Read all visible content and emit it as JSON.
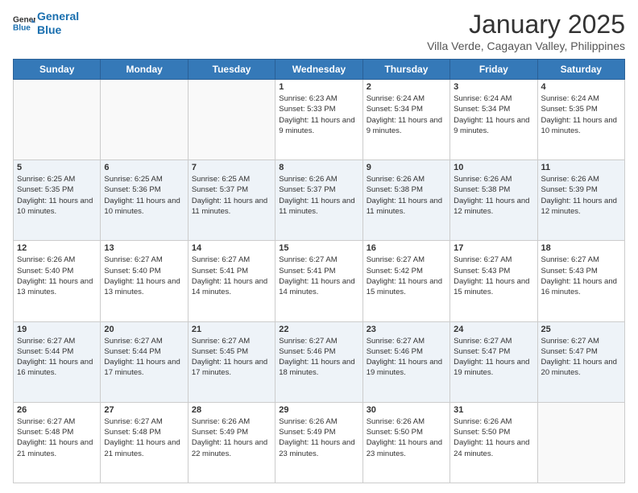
{
  "logo": {
    "line1": "General",
    "line2": "Blue"
  },
  "title": "January 2025",
  "subtitle": "Villa Verde, Cagayan Valley, Philippines",
  "weekdays": [
    "Sunday",
    "Monday",
    "Tuesday",
    "Wednesday",
    "Thursday",
    "Friday",
    "Saturday"
  ],
  "weeks": [
    [
      {
        "day": "",
        "info": ""
      },
      {
        "day": "",
        "info": ""
      },
      {
        "day": "",
        "info": ""
      },
      {
        "day": "1",
        "info": "Sunrise: 6:23 AM\nSunset: 5:33 PM\nDaylight: 11 hours and 9 minutes."
      },
      {
        "day": "2",
        "info": "Sunrise: 6:24 AM\nSunset: 5:34 PM\nDaylight: 11 hours and 9 minutes."
      },
      {
        "day": "3",
        "info": "Sunrise: 6:24 AM\nSunset: 5:34 PM\nDaylight: 11 hours and 9 minutes."
      },
      {
        "day": "4",
        "info": "Sunrise: 6:24 AM\nSunset: 5:35 PM\nDaylight: 11 hours and 10 minutes."
      }
    ],
    [
      {
        "day": "5",
        "info": "Sunrise: 6:25 AM\nSunset: 5:35 PM\nDaylight: 11 hours and 10 minutes."
      },
      {
        "day": "6",
        "info": "Sunrise: 6:25 AM\nSunset: 5:36 PM\nDaylight: 11 hours and 10 minutes."
      },
      {
        "day": "7",
        "info": "Sunrise: 6:25 AM\nSunset: 5:37 PM\nDaylight: 11 hours and 11 minutes."
      },
      {
        "day": "8",
        "info": "Sunrise: 6:26 AM\nSunset: 5:37 PM\nDaylight: 11 hours and 11 minutes."
      },
      {
        "day": "9",
        "info": "Sunrise: 6:26 AM\nSunset: 5:38 PM\nDaylight: 11 hours and 11 minutes."
      },
      {
        "day": "10",
        "info": "Sunrise: 6:26 AM\nSunset: 5:38 PM\nDaylight: 11 hours and 12 minutes."
      },
      {
        "day": "11",
        "info": "Sunrise: 6:26 AM\nSunset: 5:39 PM\nDaylight: 11 hours and 12 minutes."
      }
    ],
    [
      {
        "day": "12",
        "info": "Sunrise: 6:26 AM\nSunset: 5:40 PM\nDaylight: 11 hours and 13 minutes."
      },
      {
        "day": "13",
        "info": "Sunrise: 6:27 AM\nSunset: 5:40 PM\nDaylight: 11 hours and 13 minutes."
      },
      {
        "day": "14",
        "info": "Sunrise: 6:27 AM\nSunset: 5:41 PM\nDaylight: 11 hours and 14 minutes."
      },
      {
        "day": "15",
        "info": "Sunrise: 6:27 AM\nSunset: 5:41 PM\nDaylight: 11 hours and 14 minutes."
      },
      {
        "day": "16",
        "info": "Sunrise: 6:27 AM\nSunset: 5:42 PM\nDaylight: 11 hours and 15 minutes."
      },
      {
        "day": "17",
        "info": "Sunrise: 6:27 AM\nSunset: 5:43 PM\nDaylight: 11 hours and 15 minutes."
      },
      {
        "day": "18",
        "info": "Sunrise: 6:27 AM\nSunset: 5:43 PM\nDaylight: 11 hours and 16 minutes."
      }
    ],
    [
      {
        "day": "19",
        "info": "Sunrise: 6:27 AM\nSunset: 5:44 PM\nDaylight: 11 hours and 16 minutes."
      },
      {
        "day": "20",
        "info": "Sunrise: 6:27 AM\nSunset: 5:44 PM\nDaylight: 11 hours and 17 minutes."
      },
      {
        "day": "21",
        "info": "Sunrise: 6:27 AM\nSunset: 5:45 PM\nDaylight: 11 hours and 17 minutes."
      },
      {
        "day": "22",
        "info": "Sunrise: 6:27 AM\nSunset: 5:46 PM\nDaylight: 11 hours and 18 minutes."
      },
      {
        "day": "23",
        "info": "Sunrise: 6:27 AM\nSunset: 5:46 PM\nDaylight: 11 hours and 19 minutes."
      },
      {
        "day": "24",
        "info": "Sunrise: 6:27 AM\nSunset: 5:47 PM\nDaylight: 11 hours and 19 minutes."
      },
      {
        "day": "25",
        "info": "Sunrise: 6:27 AM\nSunset: 5:47 PM\nDaylight: 11 hours and 20 minutes."
      }
    ],
    [
      {
        "day": "26",
        "info": "Sunrise: 6:27 AM\nSunset: 5:48 PM\nDaylight: 11 hours and 21 minutes."
      },
      {
        "day": "27",
        "info": "Sunrise: 6:27 AM\nSunset: 5:48 PM\nDaylight: 11 hours and 21 minutes."
      },
      {
        "day": "28",
        "info": "Sunrise: 6:26 AM\nSunset: 5:49 PM\nDaylight: 11 hours and 22 minutes."
      },
      {
        "day": "29",
        "info": "Sunrise: 6:26 AM\nSunset: 5:49 PM\nDaylight: 11 hours and 23 minutes."
      },
      {
        "day": "30",
        "info": "Sunrise: 6:26 AM\nSunset: 5:50 PM\nDaylight: 11 hours and 23 minutes."
      },
      {
        "day": "31",
        "info": "Sunrise: 6:26 AM\nSunset: 5:50 PM\nDaylight: 11 hours and 24 minutes."
      },
      {
        "day": "",
        "info": ""
      }
    ]
  ]
}
